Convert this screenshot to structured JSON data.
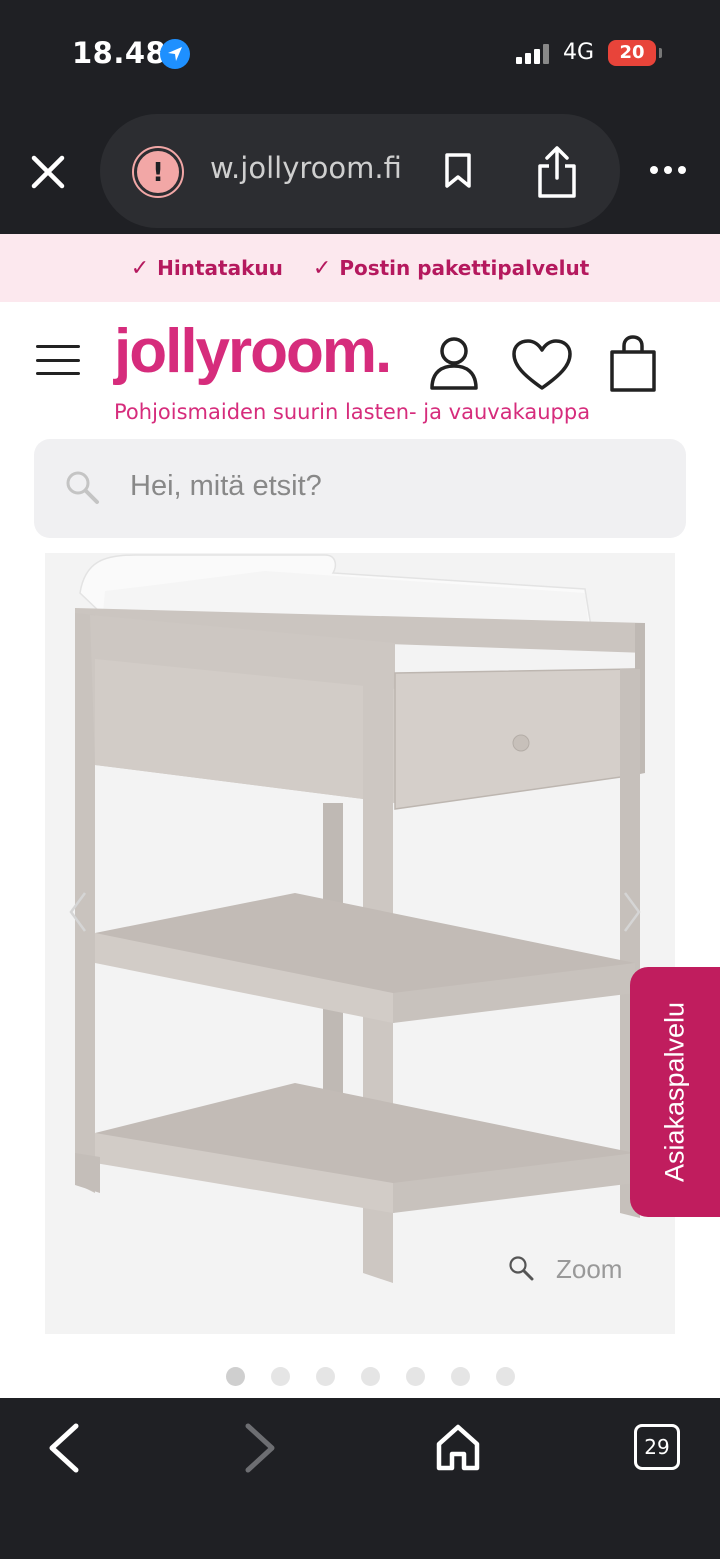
{
  "status_bar": {
    "time": "18.48",
    "network": "4G",
    "battery": "20"
  },
  "browser": {
    "url": "w.jollyroom.fi",
    "tab_count": "29"
  },
  "promo": {
    "items": [
      "Hintatakuu",
      "Postin pakettipalvelut"
    ],
    "color": "#b5195e"
  },
  "header": {
    "logo": "jollyroom.",
    "tagline": "Pohjoismaiden suurin lasten- ja vauvakauppa",
    "brand_color": "#d62c7c"
  },
  "search": {
    "placeholder": "Hei, mitä etsit?"
  },
  "product": {
    "zoom_label": "Zoom",
    "image_count": 7,
    "active_index": 0
  },
  "customer_service": {
    "label": "Asiakaspalvelu",
    "color": "#c01d5e"
  },
  "icons": [
    "location-arrow-icon",
    "close-icon",
    "warning-icon",
    "bookmark-icon",
    "share-icon",
    "more-icon",
    "hamburger-icon",
    "user-icon",
    "heart-icon",
    "bag-icon",
    "search-icon",
    "zoom-icon",
    "back-icon",
    "forward-icon",
    "home-icon",
    "tabs-icon"
  ]
}
